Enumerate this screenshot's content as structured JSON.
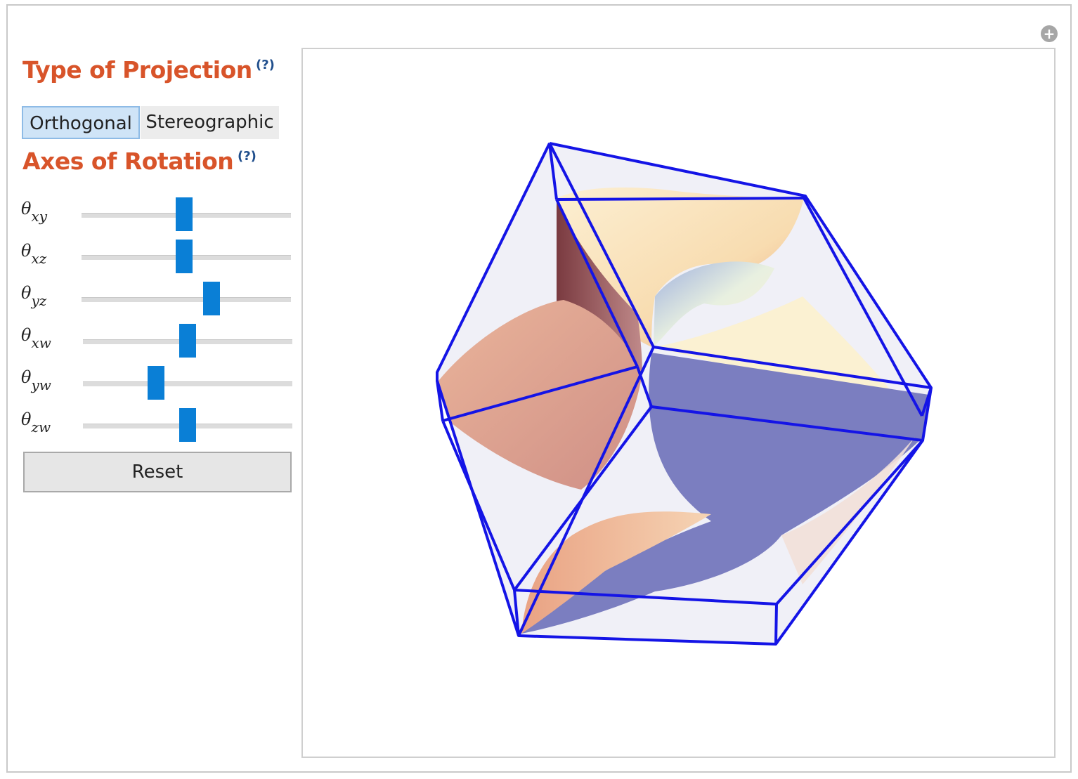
{
  "controls": {
    "projection_title": "Type of Projection",
    "projection_help": "(?)",
    "projection_options": [
      "Orthogonal",
      "Stereographic"
    ],
    "projection_selected": "Orthogonal",
    "rotation_title": "Axes of Rotation",
    "rotation_help": "(?)",
    "sliders": [
      {
        "symbol": "θ",
        "sub": "xy",
        "fraction": 0.49
      },
      {
        "symbol": "θ",
        "sub": "xz",
        "fraction": 0.49
      },
      {
        "symbol": "θ",
        "sub": "yz",
        "fraction": 0.62
      },
      {
        "symbol": "θ",
        "sub": "xw",
        "fraction": 0.5
      },
      {
        "symbol": "θ",
        "sub": "yw",
        "fraction": 0.35
      },
      {
        "symbol": "θ",
        "sub": "zw",
        "fraction": 0.5
      }
    ],
    "reset_label": "Reset"
  },
  "window": {
    "expand_icon": "plus-circle-icon"
  },
  "colors": {
    "title": "#d8542a",
    "help": "#1f4e8c",
    "slider_thumb": "#0a7fd6",
    "cube_edges": "#1414e6",
    "surface_light": "#fbe8c4",
    "surface_salmon": "#e3a48a",
    "surface_shadow": "#7b7ec0"
  }
}
